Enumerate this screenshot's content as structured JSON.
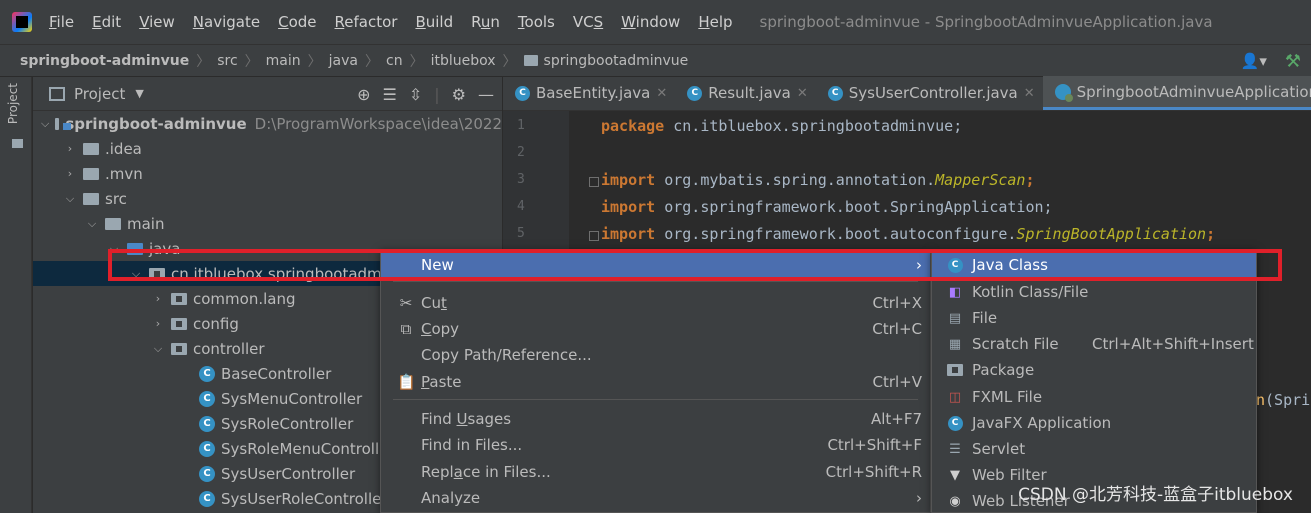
{
  "menubar": {
    "items": [
      {
        "pre": "",
        "u": "F",
        "post": "ile"
      },
      {
        "pre": "",
        "u": "E",
        "post": "dit"
      },
      {
        "pre": "",
        "u": "V",
        "post": "iew"
      },
      {
        "pre": "",
        "u": "N",
        "post": "avigate"
      },
      {
        "pre": "",
        "u": "C",
        "post": "ode"
      },
      {
        "pre": "",
        "u": "R",
        "post": "efactor"
      },
      {
        "pre": "",
        "u": "B",
        "post": "uild"
      },
      {
        "pre": "R",
        "u": "u",
        "post": "n"
      },
      {
        "pre": "",
        "u": "T",
        "post": "ools"
      },
      {
        "pre": "VC",
        "u": "S",
        "post": ""
      },
      {
        "pre": "",
        "u": "W",
        "post": "indow"
      },
      {
        "pre": "",
        "u": "H",
        "post": "elp"
      }
    ],
    "window_title": "springboot-adminvue - SpringbootAdminvueApplication.java"
  },
  "breadcrumb": {
    "items": [
      "springboot-adminvue",
      "src",
      "main",
      "java",
      "cn",
      "itbluebox",
      "springbootadminvue"
    ]
  },
  "project_panel": {
    "strip_label": "Project",
    "title": "Project"
  },
  "tree": {
    "rows": [
      {
        "label": "springboot-adminvue",
        "path": "D:\\ProgramWorkspace\\idea\\2022"
      },
      {
        "label": ".idea"
      },
      {
        "label": ".mvn"
      },
      {
        "label": "src"
      },
      {
        "label": "main"
      },
      {
        "label": "java"
      },
      {
        "label": "cn.itbluebox.springbootadm"
      },
      {
        "label": "common.lang"
      },
      {
        "label": "config"
      },
      {
        "label": "controller"
      },
      {
        "label": "BaseController"
      },
      {
        "label": "SysMenuController"
      },
      {
        "label": "SysRoleController"
      },
      {
        "label": "SysRoleMenuControll"
      },
      {
        "label": "SysUserController"
      },
      {
        "label": "SysUserRoleControlle"
      }
    ]
  },
  "tabs": [
    {
      "label": "BaseEntity.java"
    },
    {
      "label": "Result.java"
    },
    {
      "label": "SysUserController.java"
    },
    {
      "label": "SpringbootAdminvueApplication"
    }
  ],
  "editor": {
    "line_numbers": [
      "1",
      "2",
      "3",
      "4",
      "5"
    ],
    "lines": [
      {
        "kw": "package",
        "rest": " cn.itbluebox.springbootadminvue;",
        "ann": "",
        "tail": ""
      },
      {
        "kw": "",
        "rest": "",
        "ann": "",
        "tail": ""
      },
      {
        "kw": "import",
        "rest": " org.mybatis.spring.annotation.",
        "ann": "MapperScan",
        "tail": ";"
      },
      {
        "kw": "import",
        "rest": " org.springframework.boot.SpringApplication;",
        "ann": "",
        "tail": ""
      },
      {
        "kw": "import",
        "rest": " org.springframework.boot.autoconfigure.",
        "ann": "SpringBootApplication",
        "tail": ";"
      }
    ],
    "partial_glyph": "n",
    "partial_text": "(Spri"
  },
  "context_menu": {
    "new": "New",
    "cut_pre": "Cu",
    "cut_u": "t",
    "cut_short": "Ctrl+X",
    "copy_u": "C",
    "copy_post": "opy",
    "copy_short": "Ctrl+C",
    "copy_path": "Copy Path/Reference...",
    "paste_u": "P",
    "paste_post": "aste",
    "paste_short": "Ctrl+V",
    "find_usages_pre": "Find ",
    "find_usages_u": "U",
    "find_usages_post": "sages",
    "find_usages_short": "Alt+F7",
    "find_in_files": "Find in Files...",
    "find_in_files_short": "Ctrl+Shift+F",
    "replace_pre": "Repl",
    "replace_u": "a",
    "replace_post": "ce in Files...",
    "replace_short": "Ctrl+Shift+R",
    "analyze": "Analyze"
  },
  "submenu": {
    "items": [
      {
        "label": "Java Class",
        "short": ""
      },
      {
        "label": "Kotlin Class/File",
        "short": ""
      },
      {
        "label": "File",
        "short": ""
      },
      {
        "label": "Scratch File",
        "short": "Ctrl+Alt+Shift+Insert"
      },
      {
        "label": "Package",
        "short": ""
      },
      {
        "label": "FXML File",
        "short": ""
      },
      {
        "label": "JavaFX Application",
        "short": ""
      },
      {
        "label": "Servlet",
        "short": ""
      },
      {
        "label": "Web Filter",
        "short": ""
      },
      {
        "label": "Web Listener",
        "short": ""
      }
    ]
  },
  "watermark": "CSDN @北芳科技-蓝盒子itbluebox",
  "colors": {
    "selection": "#4b6eaf",
    "highlight_box": "#e0202a",
    "keyword": "#cc7832",
    "annotation": "#bbb529"
  }
}
